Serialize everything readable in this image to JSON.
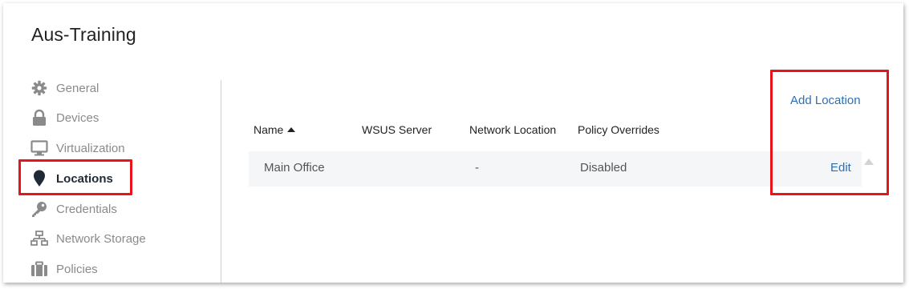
{
  "org": {
    "title": "Aus-Training"
  },
  "sidebar": {
    "items": [
      {
        "label": "General",
        "icon": "gear-icon"
      },
      {
        "label": "Devices",
        "icon": "lock-icon"
      },
      {
        "label": "Virtualization",
        "icon": "monitor-icon"
      },
      {
        "label": "Locations",
        "icon": "location-pin-icon",
        "active": true
      },
      {
        "label": "Credentials",
        "icon": "key-icon"
      },
      {
        "label": "Network Storage",
        "icon": "network-icon"
      },
      {
        "label": "Policies",
        "icon": "briefcase-icon"
      }
    ]
  },
  "actions": {
    "add_location": "Add Location"
  },
  "table": {
    "headers": [
      "Name",
      "WSUS Server",
      "Network Location",
      "Policy Overrides"
    ],
    "sorted_by": "Name",
    "rows": [
      {
        "name": "Main Office",
        "wsus": "",
        "network_location": "-",
        "policy_overrides": "Disabled",
        "edit": "Edit"
      }
    ]
  },
  "colors": {
    "highlight": "#e8141a",
    "link": "#2f6fb1",
    "active_text": "#1f2a36",
    "muted_text": "#8a8a8a"
  }
}
